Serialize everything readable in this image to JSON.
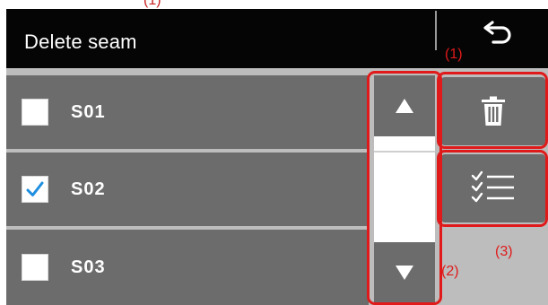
{
  "header": {
    "title": "Delete seam",
    "back_icon": "back-arrow-icon"
  },
  "seam_list": {
    "items": [
      {
        "label": "S01",
        "checked": false
      },
      {
        "label": "S02",
        "checked": true
      },
      {
        "label": "S03",
        "checked": false
      }
    ]
  },
  "scroll": {
    "up_icon": "triangle-up-icon",
    "down_icon": "triangle-down-icon"
  },
  "actions": {
    "delete_icon": "trash-icon",
    "select_all_icon": "checklist-icon"
  },
  "annotations": {
    "top_fragment": "(1)",
    "label_1": "(1)",
    "label_2": "(2)",
    "label_3": "(3)"
  },
  "colors": {
    "header_bg": "#050505",
    "row_bg": "#6c6c6c",
    "panel_bg": "#bdbdbd",
    "check_mark": "#1e8fe0",
    "annotation_red": "#e01a1a"
  }
}
